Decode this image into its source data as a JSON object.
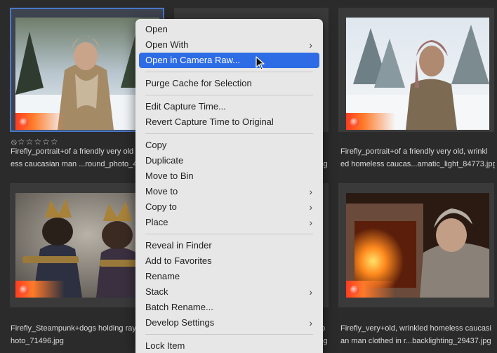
{
  "grid": {
    "items": [
      {
        "caption_line1": "Firefly_portrait+of a friendly very old",
        "caption_line2": "ess caucasian man ...round_photo_41",
        "selected": true
      },
      {
        "caption_line1": "kl",
        "caption_line2": "jpg",
        "selected": false
      },
      {
        "caption_line1": "Firefly_portrait+of a friendly very old, wrinkl",
        "caption_line2": "ed homeless caucas...amatic_light_84773.jpg",
        "selected": false
      },
      {
        "caption_line1": "Firefly_Steampunk+dogs holding ray",
        "caption_line2": "hoto_71496.jpg",
        "selected": false
      },
      {
        "caption_line1": "p",
        "caption_line2": "jpg",
        "selected": false
      },
      {
        "caption_line1": "Firefly_very+old, wrinkled homeless caucasi",
        "caption_line2": "an man clothed in r...backlighting_29437.jpg",
        "selected": false
      }
    ],
    "rating_symbols": "⦸☆☆☆☆☆"
  },
  "context_menu": {
    "groups": [
      [
        {
          "label": "Open",
          "submenu": false,
          "highlighted": false
        },
        {
          "label": "Open With",
          "submenu": true,
          "highlighted": false
        },
        {
          "label": "Open in Camera Raw...",
          "submenu": false,
          "highlighted": true
        }
      ],
      [
        {
          "label": "Purge Cache for Selection",
          "submenu": false,
          "highlighted": false
        }
      ],
      [
        {
          "label": "Edit Capture Time...",
          "submenu": false,
          "highlighted": false
        },
        {
          "label": "Revert Capture Time to Original",
          "submenu": false,
          "highlighted": false
        }
      ],
      [
        {
          "label": "Copy",
          "submenu": false,
          "highlighted": false
        },
        {
          "label": "Duplicate",
          "submenu": false,
          "highlighted": false
        },
        {
          "label": "Move to Bin",
          "submenu": false,
          "highlighted": false
        },
        {
          "label": "Move to",
          "submenu": true,
          "highlighted": false
        },
        {
          "label": "Copy to",
          "submenu": true,
          "highlighted": false
        },
        {
          "label": "Place",
          "submenu": true,
          "highlighted": false
        }
      ],
      [
        {
          "label": "Reveal in Finder",
          "submenu": false,
          "highlighted": false
        },
        {
          "label": "Add to Favorites",
          "submenu": false,
          "highlighted": false
        },
        {
          "label": "Rename",
          "submenu": false,
          "highlighted": false
        },
        {
          "label": "Stack",
          "submenu": true,
          "highlighted": false
        },
        {
          "label": "Batch Rename...",
          "submenu": false,
          "highlighted": false
        },
        {
          "label": "Develop Settings",
          "submenu": true,
          "highlighted": false
        }
      ],
      [
        {
          "label": "Lock Item",
          "submenu": false,
          "highlighted": false
        }
      ]
    ],
    "chevron_symbol": "›"
  },
  "colors": {
    "highlight": "#2e6ce6",
    "selection_outline": "#4a78c9",
    "background": "#2b2b2b"
  }
}
